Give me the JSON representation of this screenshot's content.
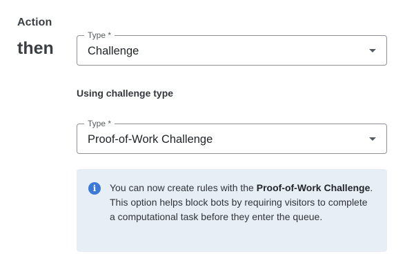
{
  "action": {
    "section_label": "Action",
    "then_label": "then",
    "type_legend": "Type *",
    "type_value": "Challenge"
  },
  "challenge": {
    "sub_heading": "Using challenge type",
    "type_legend": "Type *",
    "type_value": "Proof-of-Work Challenge"
  },
  "info": {
    "icon": "info-icon",
    "text_before": "You can now create rules with the ",
    "text_bold": "Proof-of-Work Challenge",
    "text_after": ". This option helps block bots by requiring visitors to complete a computational task before they enter the queue."
  },
  "colors": {
    "info_background": "#e8eef6",
    "info_icon": "#3b78d8",
    "select_border": "#8c9095"
  }
}
